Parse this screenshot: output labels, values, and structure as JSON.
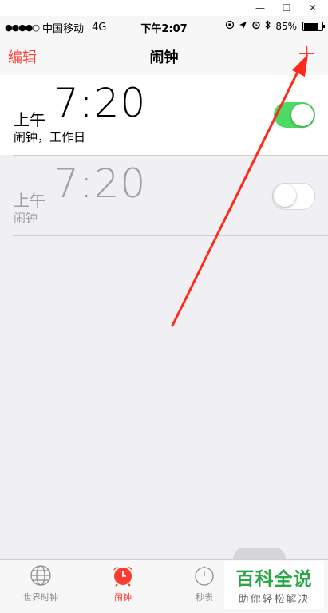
{
  "status_bar": {
    "signal": "●●●●○",
    "carrier": "中国移动",
    "network": "4G",
    "time": "下午2:07",
    "battery": "85%",
    "battery_level": 0.85
  },
  "nav": {
    "edit_label": "编辑",
    "title": "闹钟",
    "add_label": "+"
  },
  "alarms": [
    {
      "ampm": "上午",
      "time": "7:20",
      "label": "闹钟，工作日",
      "enabled": true
    },
    {
      "ampm": "上午",
      "time": "7:20",
      "label": "闹钟",
      "enabled": false
    }
  ],
  "tabs": [
    {
      "label": "世界时钟",
      "icon": "globe-icon",
      "active": false
    },
    {
      "label": "闹钟",
      "icon": "alarm-clock-icon",
      "active": true
    },
    {
      "label": "秒表",
      "icon": "stopwatch-icon",
      "active": false
    }
  ],
  "watermark": {
    "main": "百科全说",
    "sub": "助你轻松解决"
  },
  "colors": {
    "accent": "#ff3b30",
    "toggle_on": "#4cd964",
    "watermark": "#27a845"
  }
}
